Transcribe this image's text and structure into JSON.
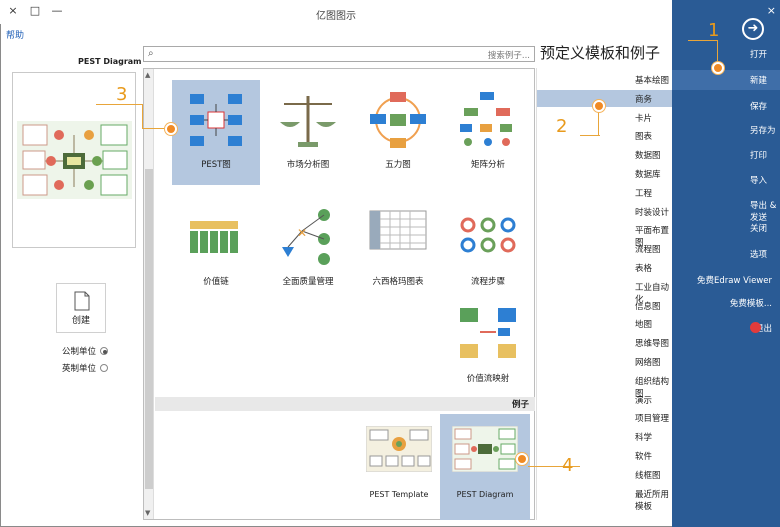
{
  "window": {
    "title": "亿图图示",
    "close": "×",
    "restore": "□",
    "minimize": "—",
    "help": "帮助"
  },
  "preview": {
    "title": "PEST Diagram"
  },
  "newdoc": {
    "label": "创建"
  },
  "units": [
    {
      "label": "公制单位",
      "selected": true
    },
    {
      "label": "英制单位",
      "selected": false
    }
  ],
  "search": {
    "placeholder": "搜索例子..."
  },
  "heading": "预定义模板和例子",
  "templates": [
    {
      "label": "PEST图",
      "selected": true
    },
    {
      "label": "市场分析图",
      "selected": false
    },
    {
      "label": "五力图",
      "selected": false
    },
    {
      "label": "矩阵分析",
      "selected": false
    },
    {
      "label": "价值链",
      "selected": false
    },
    {
      "label": "全面质量管理",
      "selected": false
    },
    {
      "label": "六西格玛图表",
      "selected": false
    },
    {
      "label": "流程步骤",
      "selected": false
    },
    {
      "label": "价值流映射",
      "selected": false
    }
  ],
  "examples_section": "例子",
  "examples": [
    {
      "label": "PEST Template",
      "selected": false
    },
    {
      "label": "PEST Diagram",
      "selected": true
    }
  ],
  "categories": [
    {
      "label": "基本绘图",
      "active": false
    },
    {
      "label": "商务",
      "active": true
    },
    {
      "label": "卡片",
      "active": false
    },
    {
      "label": "图表",
      "active": false
    },
    {
      "label": "数据图",
      "active": false
    },
    {
      "label": "数据库",
      "active": false
    },
    {
      "label": "工程",
      "active": false
    },
    {
      "label": "时装设计",
      "active": false
    },
    {
      "label": "平面布置图",
      "active": false
    },
    {
      "label": "流程图",
      "active": false
    },
    {
      "label": "表格",
      "active": false
    },
    {
      "label": "工业自动化",
      "active": false
    },
    {
      "label": "信息图",
      "active": false
    },
    {
      "label": "地图",
      "active": false
    },
    {
      "label": "思维导图",
      "active": false
    },
    {
      "label": "网络图",
      "active": false
    },
    {
      "label": "组织结构图",
      "active": false
    },
    {
      "label": "演示",
      "active": false
    },
    {
      "label": "项目管理",
      "active": false
    },
    {
      "label": "科学",
      "active": false
    },
    {
      "label": "软件",
      "active": false
    },
    {
      "label": "线框图",
      "active": false
    },
    {
      "label": "最近所用模板",
      "active": false
    }
  ],
  "sidebar": [
    {
      "label": "打开",
      "active": false
    },
    {
      "label": "新建",
      "active": true
    },
    {
      "label": "保存",
      "active": false
    },
    {
      "label": "另存为",
      "active": false
    },
    {
      "label": "打印",
      "active": false
    },
    {
      "label": "导入",
      "active": false
    },
    {
      "label": "导出 & 发送",
      "active": false
    },
    {
      "label": "关闭",
      "active": false
    },
    {
      "label": "选项",
      "active": false
    },
    {
      "label": "免费Edraw Viewer",
      "active": false
    },
    {
      "label": "免费模板...",
      "active": false
    },
    {
      "label": "退出",
      "active": false
    }
  ],
  "callouts": [
    "1",
    "2",
    "3",
    "4"
  ],
  "colors": {
    "sidebar": "#2a5b95",
    "selected": "#b4c7df",
    "callout": "#f08a24"
  }
}
